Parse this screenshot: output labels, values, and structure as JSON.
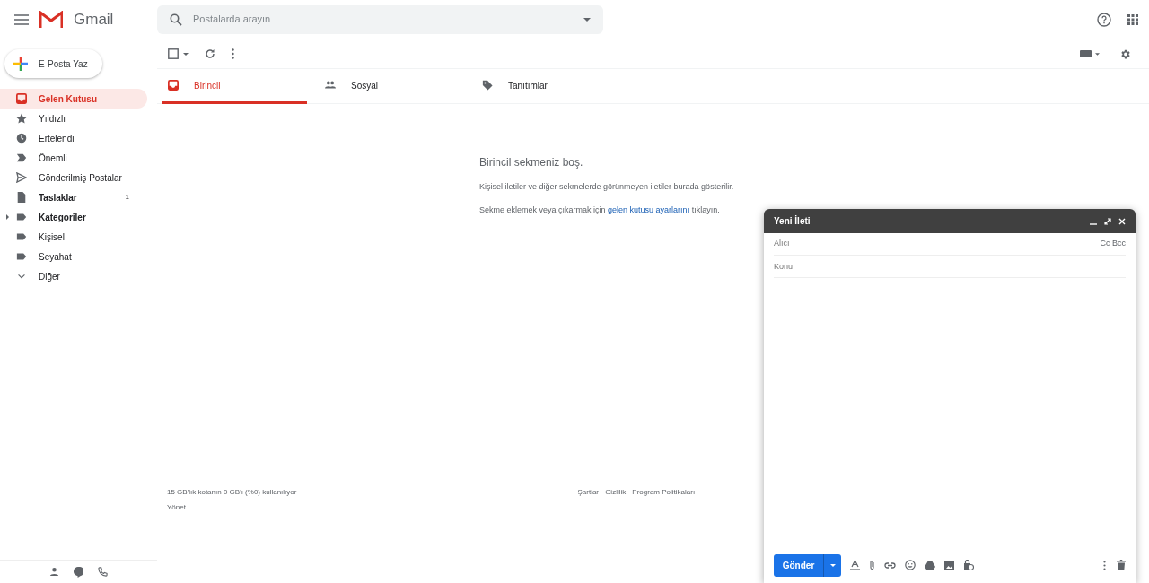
{
  "header": {
    "app_name": "Gmail",
    "search_placeholder": "Postalarda arayın"
  },
  "compose_button": "E-Posta Yaz",
  "sidebar": {
    "items": [
      {
        "kind": "inbox",
        "label": "Gelen Kutusu",
        "selected": true,
        "emphasized": true
      },
      {
        "kind": "star",
        "label": "Yıldızlı",
        "selected": false,
        "emphasized": false
      },
      {
        "kind": "clock",
        "label": "Ertelendi",
        "selected": false,
        "emphasized": false
      },
      {
        "kind": "important",
        "label": "Önemli",
        "selected": false,
        "emphasized": false
      },
      {
        "kind": "send",
        "label": "Gönderilmiş Postalar",
        "selected": false,
        "emphasized": false
      },
      {
        "kind": "draft",
        "label": "Taslaklar",
        "count": "1",
        "selected": false,
        "emphasized": true
      },
      {
        "kind": "group",
        "label": "Kategoriler",
        "selected": false,
        "emphasized": true
      },
      {
        "kind": "label",
        "label": "Kişisel",
        "selected": false,
        "emphasized": false
      },
      {
        "kind": "label",
        "label": "Seyahat",
        "selected": false,
        "emphasized": false
      },
      {
        "kind": "more",
        "label": "Diğer",
        "selected": false,
        "emphasized": false
      }
    ]
  },
  "tabs": [
    {
      "kind": "inbox",
      "label": "Birincil",
      "selected": true
    },
    {
      "kind": "people",
      "label": "Sosyal",
      "selected": false
    },
    {
      "kind": "tag",
      "label": "Tanıtımlar",
      "selected": false
    }
  ],
  "empty_state": {
    "title": "Birincil sekmeniz boş.",
    "line": "Kişisel iletiler ve diğer sekmelerde görünmeyen iletiler burada gösterilir.",
    "hint_prefix": "Sekme eklemek veya çıkarmak için",
    "hint_link": "gelen kutusu ayarlarını",
    "hint_suffix": "tıklayın."
  },
  "footer": {
    "storage": "15 GB'lık kotanın 0 GB'ı (%0) kullanılıyor",
    "manage": "Yönet",
    "links": "Şartlar · Gizlilik · Program Politikaları"
  },
  "compose": {
    "title": "Yeni İleti",
    "to_placeholder": "Alıcı",
    "cc_bcc": "Cc Bcc",
    "subject_placeholder": "Konu",
    "send": "Gönder"
  }
}
